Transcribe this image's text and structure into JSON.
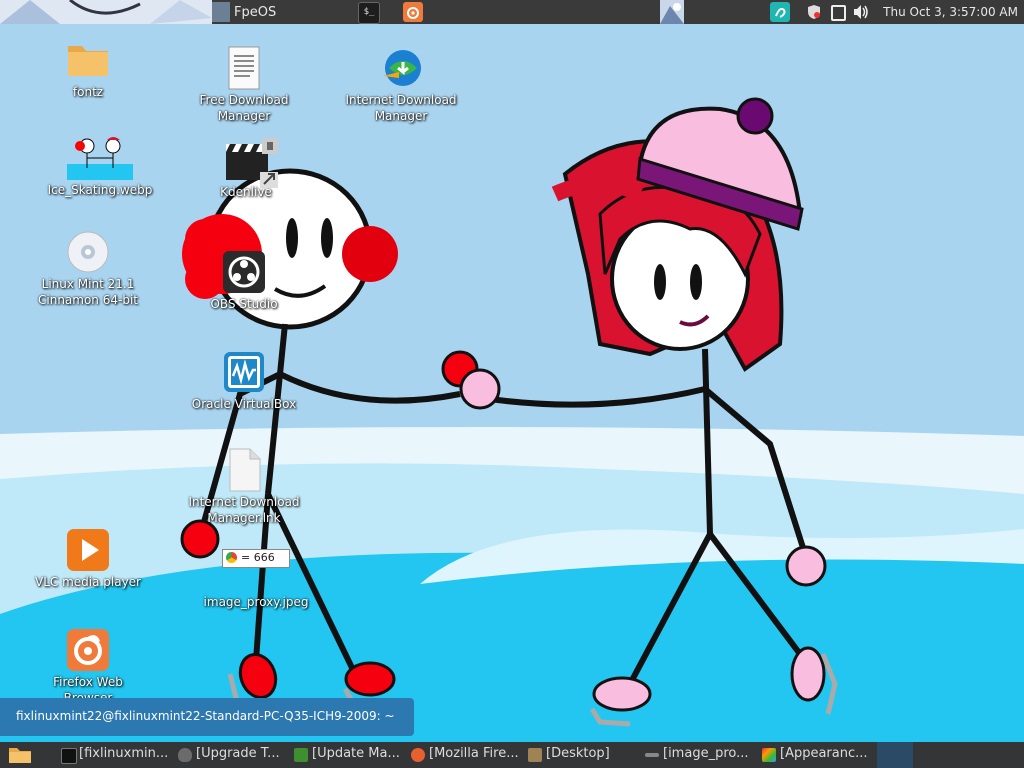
{
  "top_panel": {
    "app_title": "FpeOS",
    "clock": "Thu Oct  3,  3:57:00 AM",
    "tray_icons": [
      "terminal-icon",
      "firefox-icon",
      "image-thumbnail-icon",
      "accessibility-icon",
      "shield-icon",
      "window-icon",
      "volume-icon"
    ]
  },
  "desktop": {
    "icons": [
      {
        "label": "fontz",
        "icon": "folder-icon"
      },
      {
        "label": "Free Download Manager",
        "icon": "document-icon"
      },
      {
        "label": "Internet Download Manager",
        "icon": "idm-icon"
      },
      {
        "label": "Ice_Skating.webp",
        "icon": "image-icon"
      },
      {
        "label": "Kdenlive",
        "icon": "clapper-icon"
      },
      {
        "label": "Linux Mint 21.1 Cinnamon 64-bit",
        "icon": "disc-icon"
      },
      {
        "label": "OBS Studio",
        "icon": "obs-icon"
      },
      {
        "label": "Oracle VirtualBox",
        "icon": "virtualbox-icon"
      },
      {
        "label": "Internet Download Manager.lnk",
        "icon": "blank-file-icon"
      },
      {
        "label": "VLC media player",
        "icon": "vlc-icon"
      },
      {
        "label": "image_proxy.jpeg",
        "icon": "image-icon"
      },
      {
        "label": "Firefox Web Browser",
        "icon": "firefox-icon"
      }
    ],
    "tooltip": "= 666"
  },
  "notification": {
    "text": "fixlinuxmint22@fixlinuxmint22-Standard-PC-Q35-ICH9-2009: ~"
  },
  "taskbar": {
    "items": [
      {
        "label": "[fixlinuxmin...",
        "icon": "terminal-icon"
      },
      {
        "label": "[Upgrade T...",
        "icon": "shield-icon"
      },
      {
        "label": "[Update Ma...",
        "icon": "update-shield-icon"
      },
      {
        "label": "[Mozilla Fire...",
        "icon": "firefox-icon"
      },
      {
        "label": "[Desktop]",
        "icon": "folder-icon"
      },
      {
        "label": "[image_pro...",
        "icon": "image-viewer-icon"
      },
      {
        "label": "[Appearanc...",
        "icon": "palette-icon"
      }
    ]
  },
  "colors": {
    "sky": "#a9d4ef",
    "water": "#22c6f0",
    "ice_white": "#f2fbff",
    "panel": "#333537",
    "notification": "#2c78b0"
  }
}
